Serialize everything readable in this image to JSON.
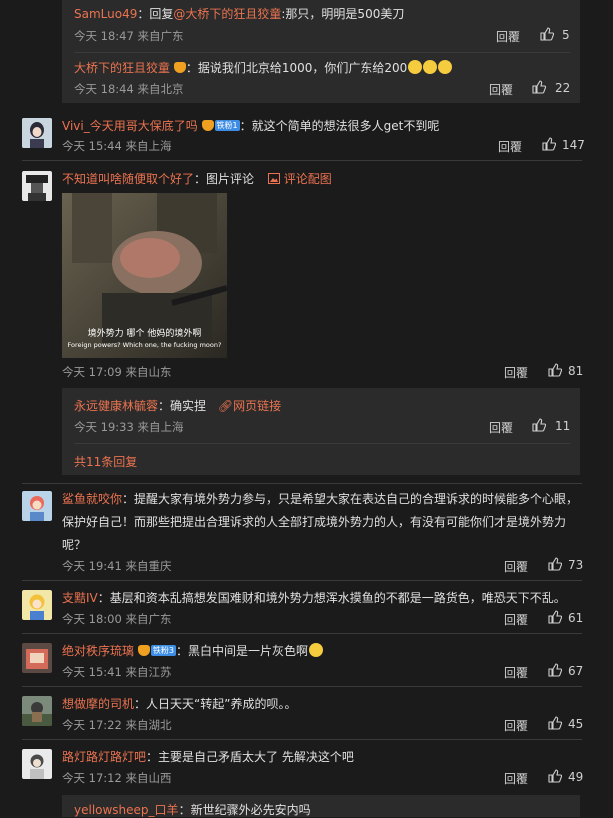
{
  "reply_label": "回覆",
  "comments": [
    {
      "name": "Vivi_今天用哥大保底了吗",
      "badge": "铁粉1",
      "text": "：就这个简单的想法很多人get不到呢",
      "time": "今天 15:44 来自上海",
      "likes": "147"
    },
    {
      "name": "不知道叫啥随便取个好了",
      "text": "：图片评论",
      "link": "评论配图",
      "image_caption": "境外势力  哪个  他妈的境外啊",
      "image_caption_en": "Foreign powers? Which one, the fucking moon?",
      "time": "今天 17:09 来自山东",
      "likes": "81"
    },
    {
      "name": "鲨鱼就咬你",
      "text": "：提醒大家有境外势力参与，只是希望大家在表达自己的合理诉求的时候能多个心眼，",
      "text2": "保护好自己！而那些把提出合理诉求的人全部打成境外势力的人，有没有可能你们才是境外势力",
      "text3": "呢？",
      "time": "今天 19:41 来自重庆",
      "likes": "73"
    },
    {
      "name": "支黠IV",
      "text": "：基层和资本乱搞想发国难财和境外势力想浑水摸鱼的不都是一路货色，唯恐天下不乱。",
      "time": "今天 18:00 来自广东",
      "likes": "61"
    },
    {
      "name": "绝对秩序琉璃",
      "badge": "铁粉3",
      "text": "：黑白中间是一片灰色啊",
      "time": "今天 15:41 来自江苏",
      "likes": "67"
    },
    {
      "name": "想做摩的司机",
      "text": "：人日天天“转起”养成的呗。。",
      "time": "今天 17:22 来自湖北",
      "likes": "45"
    },
    {
      "name": "路灯路灯路灯吧",
      "text": "：主要是自己矛盾太大了 先解决这个吧",
      "time": "今天 17:12 来自山西",
      "likes": "49"
    }
  ],
  "sub_replies": [
    {
      "name": "SamLuo49",
      "text_prefix": "：回复",
      "mention": "@大桥下的狂且狡童",
      "text": ":那只，明明是500美刀",
      "time": "今天 18:47 来自广东",
      "likes": "5"
    },
    {
      "name": "大桥下的狂且狡童",
      "text": "：据说我们北京给1000，你们广东给200",
      "time": "今天 18:44 来自北京",
      "likes": "22"
    },
    {
      "name": "永远健康林毓蓉",
      "text": "：确实捏",
      "link": "网页链接",
      "time": "今天 19:33 来自上海",
      "likes": "11"
    },
    {
      "name": "yellowsheep_口羊",
      "text": "：新世纪骤外必先安内吗"
    }
  ],
  "more_replies": "共11条回复"
}
